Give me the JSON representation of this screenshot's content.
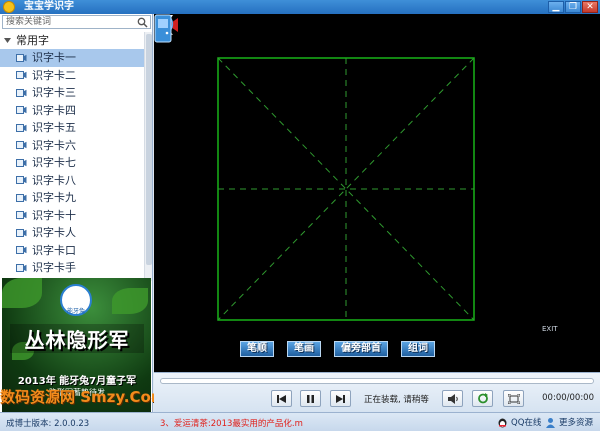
{
  "window": {
    "title": "宝宝学识字",
    "minimize": "▁",
    "restore": "❐",
    "close": "✕"
  },
  "sidebar": {
    "search_placeholder": "搜索关键词",
    "root_label": "常用字",
    "items": [
      {
        "label": "识字卡一",
        "selected": true
      },
      {
        "label": "识字卡二"
      },
      {
        "label": "识字卡三"
      },
      {
        "label": "识字卡四"
      },
      {
        "label": "识字卡五"
      },
      {
        "label": "识字卡六"
      },
      {
        "label": "识字卡七"
      },
      {
        "label": "识字卡八"
      },
      {
        "label": "识字卡九"
      },
      {
        "label": "识字卡十"
      },
      {
        "label": "识字卡人"
      },
      {
        "label": "识字卡口"
      },
      {
        "label": "识字卡手"
      }
    ]
  },
  "ad": {
    "badge": "能牙兔",
    "title": "丛林隐形军",
    "line1": "2013年 能牙兔7月童子军",
    "line2": "隐形军蓄势待发"
  },
  "watermark": "数码资源网 Smzy.Com",
  "stage": {
    "exit_label": "EXIT",
    "buttons": [
      "笔顺",
      "笔画",
      "偏旁部首",
      "组词"
    ]
  },
  "player": {
    "progress": 0,
    "status_text": "正在装载, 请稍等",
    "time_text": "00:00/00:00"
  },
  "statusbar": {
    "version": "成博士版本: 2.0.0.23",
    "notice": "3、爱运清茶:2013最实用的产品化.m",
    "qq_label": "QQ在线",
    "more_label": "更多资源"
  },
  "colors": {
    "stage_bg": "#000000",
    "grid_border": "#19b319",
    "grid_dash": "#2f9a2f",
    "accent": "#2570c0"
  }
}
